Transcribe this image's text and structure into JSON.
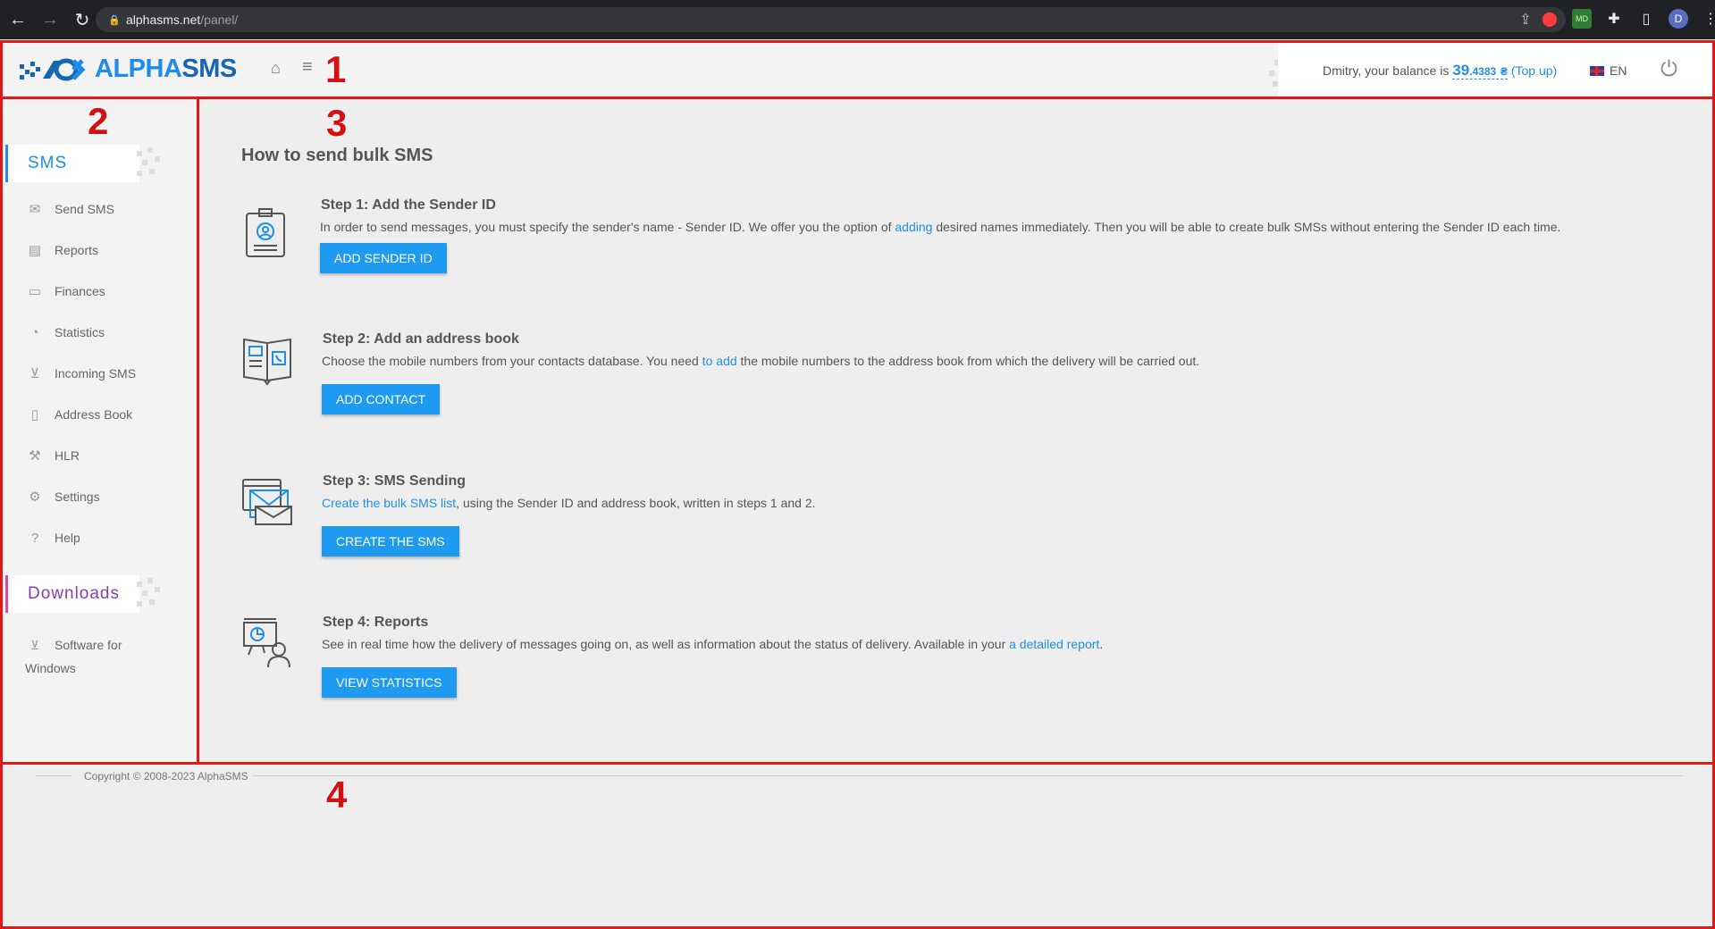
{
  "browser": {
    "url_host": "alphasms.net",
    "url_path": "/panel/",
    "profile_initial": "D",
    "extension_badge": "MD"
  },
  "header": {
    "logo_text_a": "ALPHA",
    "logo_text_b": "SMS",
    "balance_prefix": "Dmitry, your balance is",
    "balance_whole": "39",
    "balance_fraction": ".4383",
    "currency": "₴",
    "topup_open": " (",
    "topup_label": "Top up",
    "topup_close": ")",
    "language": "EN"
  },
  "sidebar": {
    "sms_heading": "SMS",
    "items": [
      {
        "label": "Send SMS",
        "icon": "envelope-icon"
      },
      {
        "label": "Reports",
        "icon": "document-icon"
      },
      {
        "label": "Finances",
        "icon": "wallet-icon"
      },
      {
        "label": "Statistics",
        "icon": "pie-chart-icon"
      },
      {
        "label": "Incoming SMS",
        "icon": "download-circle-icon"
      },
      {
        "label": "Address Book",
        "icon": "book-icon"
      },
      {
        "label": "HLR",
        "icon": "wrench-icon"
      },
      {
        "label": "Settings",
        "icon": "gear-icon"
      },
      {
        "label": "Help",
        "icon": "help-icon"
      }
    ],
    "downloads_heading": "Downloads",
    "software_line1": "Software for",
    "software_line2": "Windows"
  },
  "main": {
    "title": "How to send bulk SMS",
    "steps": [
      {
        "title": "Step 1: Add the Sender ID",
        "desc_before": "In order to send messages, you must specify the sender's name - Sender ID. We offer you the option of ",
        "desc_link": "adding",
        "desc_after": " desired names immediately. Then you will be able to create bulk SMSs without entering the Sender ID each time.",
        "button": "ADD SENDER ID"
      },
      {
        "title": "Step 2: Add an address book",
        "desc_before": "Choose the mobile numbers from your contacts database. You need ",
        "desc_link": "to add",
        "desc_after": " the mobile numbers to the address book from which the delivery will be carried out.",
        "button": "ADD CONTACT"
      },
      {
        "title": "Step 3: SMS Sending",
        "desc_before": "",
        "desc_link": "Create the bulk SMS list",
        "desc_after": ", using the Sender ID and address book, written in steps 1 and 2.",
        "button": "CREATE THE SMS"
      },
      {
        "title": "Step 4: Reports",
        "desc_before": "See in real time how the delivery of messages going on, as well as information about the status of delivery. Available in your ",
        "desc_link": "a detailed report",
        "desc_after": ".",
        "button": "VIEW STATISTICS"
      }
    ]
  },
  "footer": {
    "copyright": "Copyright © 2008-2023 AlphaSMS"
  },
  "annotations": [
    "1",
    "2",
    "3",
    "4"
  ],
  "colors": {
    "accent": "#1e8fe8",
    "annotation": "#e01818",
    "downloads": "#8a3fa8"
  }
}
